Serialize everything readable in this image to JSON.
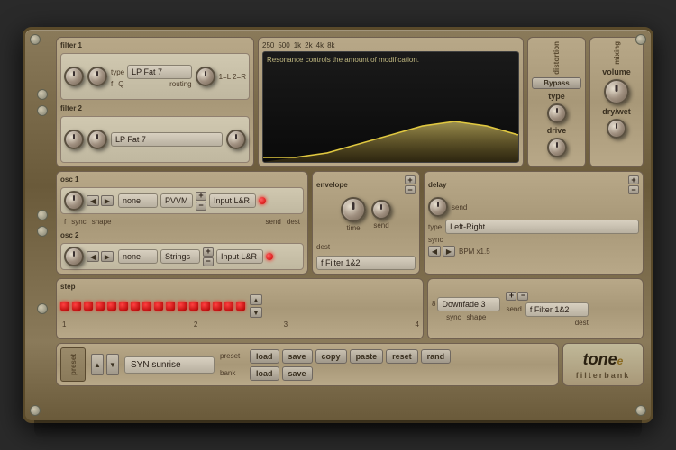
{
  "synth": {
    "title": "Tone-e Filterbank",
    "logo": "tone-e",
    "logo_sub": "filterbank",
    "filters": {
      "label": "filter",
      "filter1": {
        "label": "filter 1",
        "type_label": "type",
        "type_value": "LP Fat 7",
        "f_label": "f",
        "q_label": "Q",
        "routing_label": "routing",
        "routing_value": "1=L 2=R"
      },
      "filter2": {
        "label": "filter 2",
        "type_value": "LP Fat 7"
      }
    },
    "eq": {
      "freq_labels": [
        "250",
        "500",
        "1k",
        "2k",
        "4k",
        "8k"
      ],
      "desc": "Resonance controls the amount of modification."
    },
    "distortion": {
      "label": "distortion",
      "bypass_label": "Bypass",
      "type_label": "type",
      "drive_label": "drive"
    },
    "mixing": {
      "label": "mixing",
      "volume_label": "volume",
      "drywet_label": "dry/wet"
    },
    "osc": {
      "label": "osc",
      "osc1": {
        "label": "osc 1",
        "f_label": "f",
        "sync_label": "sync",
        "shape_label": "shape",
        "send_label": "send",
        "dest_label": "dest",
        "waveform": "none",
        "modulation": "PVVM",
        "destination": "Input L&R"
      },
      "osc2": {
        "label": "osc 2",
        "waveform": "none",
        "modulation": "Strings",
        "destination": "Input L&R"
      }
    },
    "envelope": {
      "label": "envelope",
      "time_label": "time",
      "send_label": "send",
      "dest_label": "dest",
      "dest_value": "f Filter 1&2"
    },
    "delay": {
      "label": "delay",
      "send_label": "send",
      "type_label": "type",
      "type_value": "Left-Right",
      "sync_label": "sync",
      "bpm_label": "BPM x1.5"
    },
    "step": {
      "label": "step",
      "markers": [
        "1",
        "2",
        "3",
        "4"
      ],
      "dots_on": [
        1,
        1,
        1,
        1,
        1,
        1,
        1,
        1,
        1,
        1,
        1,
        1,
        1,
        1,
        1,
        1
      ],
      "sync_label": "sync",
      "shape_label": "shape",
      "shape_value": "8",
      "shape_type": "Downfade 3",
      "send_label": "send",
      "dest_label": "dest",
      "dest_value": "f Filter 1&2"
    },
    "preset": {
      "label": "preset",
      "preset_name": "SYN sunrise",
      "preset_label": "preset",
      "bank_label": "bank",
      "load_label": "load",
      "save_label": "save",
      "copy_label": "copy",
      "paste_label": "paste",
      "reset_label": "reset",
      "rand_label": "rand"
    }
  }
}
